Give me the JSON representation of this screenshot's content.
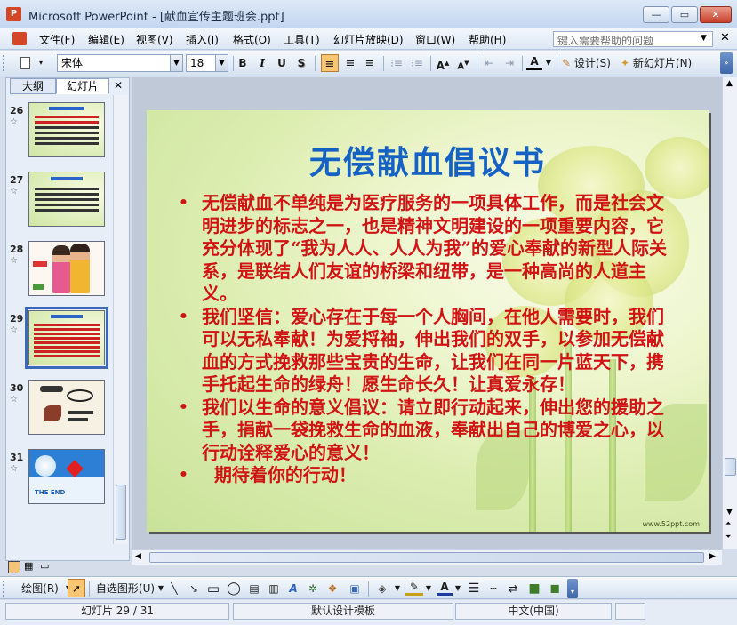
{
  "window": {
    "app_icon": "powerpoint-icon",
    "title": "Microsoft PowerPoint - [献血宣传主题班会.ppt]",
    "controls": {
      "minimize": "—",
      "restore": "▭",
      "close": "✕"
    }
  },
  "menu": {
    "items": [
      "文件(F)",
      "编辑(E)",
      "视图(V)",
      "插入(I)",
      "格式(O)",
      "工具(T)",
      "幻灯片放映(D)",
      "窗口(W)",
      "帮助(H)"
    ],
    "help_placeholder": "键入需要帮助的问题"
  },
  "formatting": {
    "font": "宋体",
    "size": "18",
    "bold": "B",
    "italic": "I",
    "underline": "U",
    "shadow": "S",
    "font_color_label": "A",
    "design_label": "设计(S)",
    "new_slide_label": "新幻灯片(N)"
  },
  "left_pane": {
    "tabs": [
      "大纲",
      "幻灯片"
    ],
    "active_tab": "幻灯片",
    "close": "✕",
    "thumbnails": [
      {
        "number": "26",
        "selected": false
      },
      {
        "number": "27",
        "selected": false
      },
      {
        "number": "28",
        "selected": false
      },
      {
        "number": "29",
        "selected": true
      },
      {
        "number": "30",
        "selected": false
      },
      {
        "number": "31",
        "selected": false,
        "text": "THE END"
      }
    ]
  },
  "slide": {
    "title": "无偿献血倡议书",
    "bullets": [
      "无偿献血不单纯是为医疗服务的一项具体工作，而是社会文明进步的标志之一，也是精神文明建设的一项重要内容，它充分体现了“我为人人、人人为我”的爱心奉献的新型人际关系，是联结人们友谊的桥梁和纽带，是一种高尚的人道主义。",
      "我们坚信：爱心存在于每一个人胸间，在他人需要时，我们可以无私奉献！为爱捋袖，伸出我们的双手，以参加无偿献血的方式挽救那些宝贵的生命，让我们在同一片蓝天下，携手托起生命的绿舟！愿生命长久！让真爱永存！",
      "我们以生命的意义倡议：请立即行动起来，伸出您的援助之手，捐献一袋挽救生命的血液，奉献出自己的博爱之心，以行动诠释爱心的意义！",
      "  期待着你的行动！"
    ],
    "bullet_glyph": "•",
    "watermark": "www.52ppt.com",
    "colors": {
      "title": "#1662c4",
      "body": "#d01414"
    }
  },
  "drawing": {
    "draw_label": "绘图(R)",
    "autoshapes_label": "自选图形(U)"
  },
  "status": {
    "slide_position": "幻灯片 29 / 31",
    "template": "默认设计模板",
    "language": "中文(中国)"
  }
}
